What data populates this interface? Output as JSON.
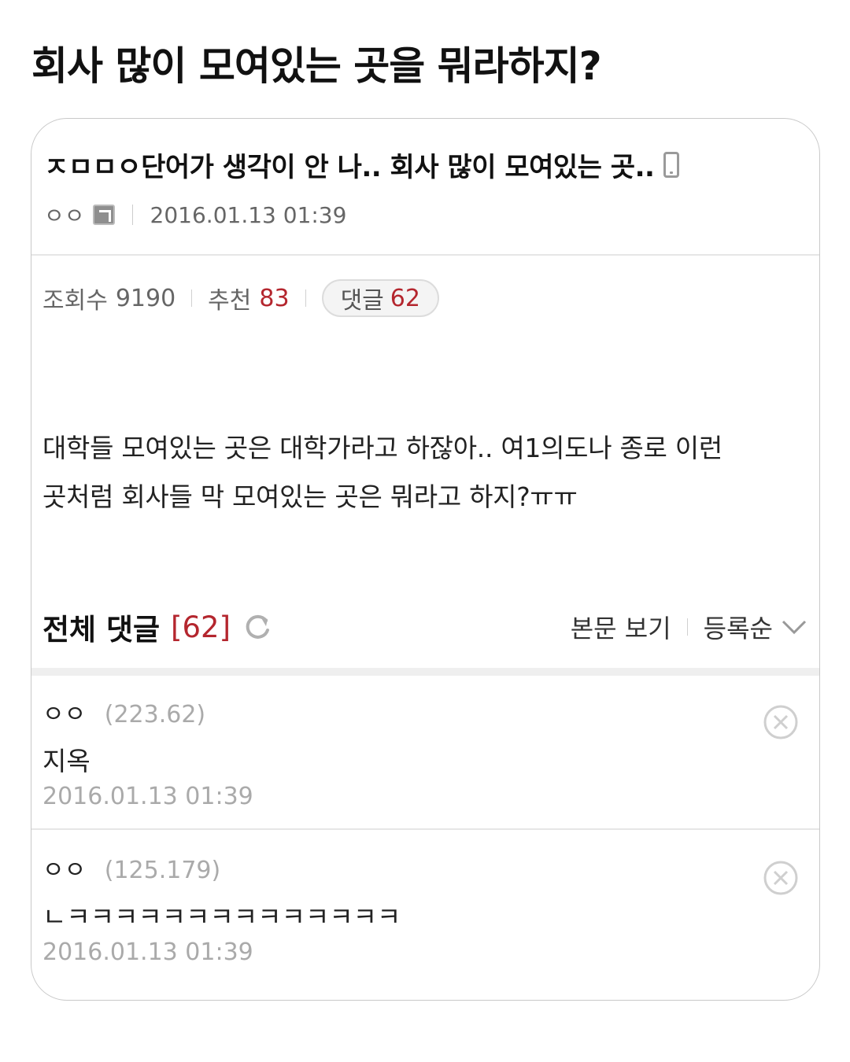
{
  "heading": "회사 많이 모여있는 곳을 뭐라하지?",
  "post": {
    "title": "ㅈㅁㅁㅇ단어가 생각이 안 나.. 회사 많이 모여있는 곳..",
    "author": "ㅇㅇ",
    "date": "2016.01.13 01:39",
    "views_label": "조회수",
    "views": "9190",
    "likes_label": "추천",
    "likes": "83",
    "comments_label": "댓글",
    "comments": "62",
    "body_line1": "대학들 모여있는 곳은 대학가라고 하잖아.. 여1의도나 종로 이런",
    "body_line2": "곳처럼 회사들 막 모여있는 곳은 뭐라고 하지?ㅠㅠ"
  },
  "comments_section": {
    "title": "전체 댓글",
    "count": "[62]",
    "view_body_label": "본문 보기",
    "sort_label": "등록순"
  },
  "comments": [
    {
      "author": "ㅇㅇ",
      "ip": "(223.62)",
      "text": "지옥",
      "date": "2016.01.13 01:39"
    },
    {
      "author": "ㅇㅇ",
      "ip": "(125.179)",
      "text": "ㄴㅋㅋㅋㅋㅋㅋㅋㅋㅋㅋㅋㅋㅋㅋ",
      "date": "2016.01.13 01:39"
    }
  ],
  "colors": {
    "accent": "#b4262e",
    "muted": "#aaaaaa",
    "border": "#c9c9c9"
  },
  "icons": [
    "phone-icon",
    "level-icon",
    "refresh-icon",
    "chevron-down-icon",
    "delete-icon"
  ]
}
